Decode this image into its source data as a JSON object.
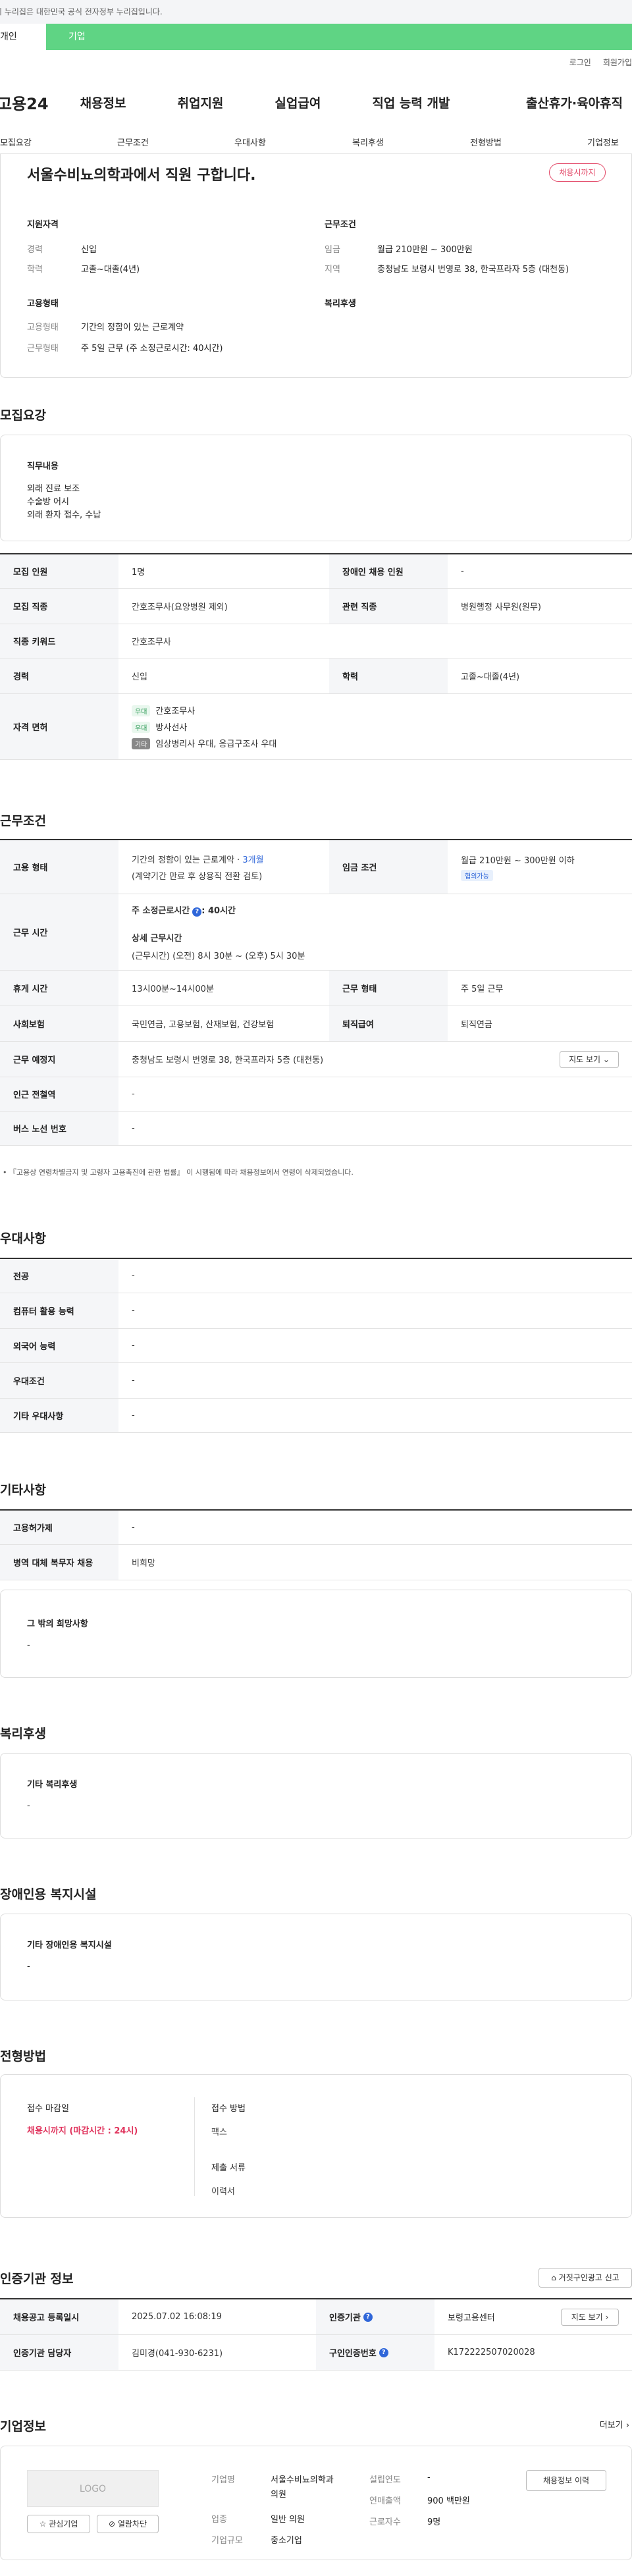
{
  "gov_banner": "이 누리집은 대한민국 공식 전자정부 누리집입니다.",
  "tabs": {
    "a": "개인",
    "b": "기업"
  },
  "util": {
    "login": "로그인",
    "join": "회원가입"
  },
  "gnb": {
    "logo": "고용24",
    "items": [
      "채용정보",
      "취업지원",
      "실업급여",
      "직업 능력 개발",
      "출산휴가·육아휴직"
    ]
  },
  "subnav": [
    "모집요강",
    "근무조건",
    "우대사항",
    "복리후생",
    "전형방법",
    "기업정보"
  ],
  "summary": {
    "title": "서울수비뇨의학과에서 직원 구합니다.",
    "status_pill": "채용시까지",
    "qual_title": "지원자격",
    "career_label": "경력",
    "career": "신입",
    "edu_label": "학력",
    "edu": "고졸~대졸(4년)",
    "cond_title": "근무조건",
    "pay_label": "임금",
    "pay": "월급 210만원 ~ 300만원",
    "area_label": "지역",
    "area": "충청남도 보령시 번영로 38, 한국프라자 5층 (대천동)",
    "emp_title": "고용형태",
    "emp_type_label": "고용형태",
    "emp_type": "기간의 정함이 있는 근로계약",
    "work_label": "근무형태",
    "work": "주 5일 근무 (주 소정근로시간: 40시간)",
    "welfare_title": "복리후생"
  },
  "recruit": {
    "title": "모집요강",
    "duty_title": "직무내용",
    "duty_lines": [
      "외래 진료 보조",
      "수술방 어시",
      "외래 환자 접수, 수납"
    ],
    "rows": {
      "count_l": "모집 인원",
      "count": "1명",
      "disabled_l": "장애인 채용 인원",
      "disabled": "-",
      "job_l": "모집 직종",
      "job": "간호조무사(요양병원 제외)",
      "rel_l": "관련 직종",
      "rel": "병원행정 사무원(원무)",
      "kw_l": "직종 키워드",
      "kw": "간호조무사",
      "career_l": "경력",
      "career": "신입",
      "edu_l": "학력",
      "edu": "고졸~대졸(4년)",
      "lic_l": "자격 면허",
      "lic1_badge": "우대",
      "lic1": "간호조무사",
      "lic2_badge": "우대",
      "lic2": "방사선사",
      "lic3_badge": "기타",
      "lic3": "임상병리사 우대, 응급구조사 우대"
    }
  },
  "work": {
    "title": "근무조건",
    "emp_l": "고용 형태",
    "emp1": "기간의 정함이 있는 근로계약 · ",
    "emp1_period": "3개월",
    "emp2": "(계약기간 만료 후 상용직 전환 검토)",
    "pay_l": "임금 조건",
    "pay": "월급 210만원 ~ 300만원 이하",
    "pay_badge": "협의가능",
    "hours_l": "근무 시간",
    "hours1": "주 소정근로시간",
    "hours1_val": ": 40시간",
    "hours2": "상세 근무시간",
    "hours3": "(근무시간) (오전) 8시 30분 ~ (오후) 5시 30분",
    "rest_l": "휴게 시간",
    "rest": "13시00분~14시00분",
    "form_l": "근무 형태",
    "form": "주 5일 근무",
    "ins_l": "사회보험",
    "ins": "국민연금, 고용보험, 산재보험, 건강보험",
    "ret_l": "퇴직급여",
    "ret": "퇴직연금",
    "loc_l": "근무 예정지",
    "loc": "충청남도 보령시 번영로 38, 한국프라자 5층 (대천동)",
    "map_btn": "지도 보기",
    "sub_l": "인근 전철역",
    "sub": "-",
    "bus_l": "버스 노선 번호",
    "bus": "-",
    "note": "『고용상 연령차별금지 및 고령자 고용촉진에 관한 법률』 이 시행됨에 따라 채용정보에서 연령이 삭제되었습니다."
  },
  "pref": {
    "title": "우대사항",
    "major_l": "전공",
    "major": "-",
    "pc_l": "컴퓨터 활용 능력",
    "pc": "-",
    "lang_l": "외국어 능력",
    "lang": "-",
    "cond_l": "우대조건",
    "cond": "-",
    "etc_l": "기타 우대사항",
    "etc": "-"
  },
  "other": {
    "title": "기타사항",
    "sub_l": "고용허가제",
    "sub": "-",
    "mil_l": "병역 대체 복무자 채용",
    "mil": "비희망",
    "wish_title": "그 밖의 희망사항",
    "wish": "-"
  },
  "welfare": {
    "title": "복리후생",
    "box_title": "기타 복리후생",
    "box_val": "-"
  },
  "facility": {
    "title": "장애인용 복지시설",
    "box_title": "기타 장애인용 복지시설",
    "box_val": "-"
  },
  "screen": {
    "title": "전형방법",
    "deadline_l": "접수 마감일",
    "deadline": "채용시까지 (마감시간 : 24시)",
    "method_l": "접수 방법",
    "method": "팩스",
    "docs_l": "제출 서류",
    "docs": "이력서"
  },
  "cert": {
    "title": "인증기관 정보",
    "report_btn": "거짓구인광고 신고",
    "reg_l": "채용공고 등록일시",
    "reg": "2025.07.02 16:08:19",
    "inst_l": "인증기관",
    "inst": "보령고용센터",
    "map_btn": "지도 보기",
    "mgr_l": "인증기관 담당자",
    "mgr": "김미경(041-930-6231)",
    "no_l": "구인인증번호",
    "no": "K172222507020028"
  },
  "company": {
    "title": "기업정보",
    "more": "더보기",
    "logo": "LOGO",
    "fav_btn": "관심기업",
    "block_btn": "열람차단",
    "name_l": "기업명",
    "name1": "서울수비뇨의학과",
    "name2": "의원",
    "ind_l": "업종",
    "ind": "일반 의원",
    "size_l": "기업규모",
    "size": "중소기업",
    "year_l": "설립연도",
    "year": "-",
    "sales_l": "연매출액",
    "sales": "900 백만원",
    "emp_l": "근로자수",
    "emp": "9명",
    "hist_btn": "채용정보 이력"
  }
}
